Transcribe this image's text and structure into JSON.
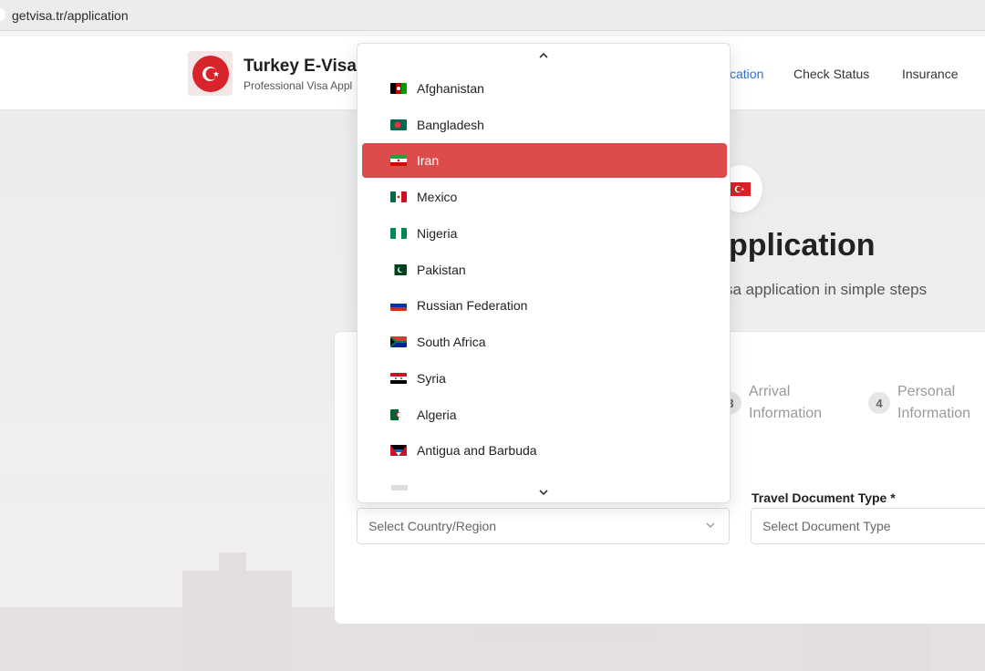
{
  "browser": {
    "url": "getvisa.tr/application"
  },
  "header": {
    "brand_title": "Turkey E-Visa",
    "brand_subtitle": "Professional Visa Appl",
    "nav": {
      "application": "cation",
      "check_status": "Check Status",
      "insurance": "Insurance"
    }
  },
  "hero": {
    "title": "pplication",
    "subtitle": "sa application in simple steps"
  },
  "steps": [
    {
      "number": "3",
      "label_line1": "Arrival",
      "label_line2": "Information"
    },
    {
      "number": "4",
      "label_line1": "Personal",
      "label_line2": "Information"
    }
  ],
  "form": {
    "travel_doc_label": "Travel Document Type *",
    "country_placeholder": "Select Country/Region",
    "doc_placeholder": "Select Document Type"
  },
  "dropdown": {
    "selected": "Iran",
    "options": [
      {
        "label": "Afghanistan",
        "flag": "afghanistan"
      },
      {
        "label": "Bangladesh",
        "flag": "bangladesh"
      },
      {
        "label": "Iran",
        "flag": "iran"
      },
      {
        "label": "Mexico",
        "flag": "mexico"
      },
      {
        "label": "Nigeria",
        "flag": "nigeria"
      },
      {
        "label": "Pakistan",
        "flag": "pakistan"
      },
      {
        "label": "Russian Federation",
        "flag": "russia"
      },
      {
        "label": "South Africa",
        "flag": "south-africa"
      },
      {
        "label": "Syria",
        "flag": "syria"
      },
      {
        "label": "Algeria",
        "flag": "algeria"
      },
      {
        "label": "Antigua and Barbuda",
        "flag": "antigua"
      }
    ]
  },
  "colors": {
    "selected_bg": "#dc4c4a",
    "nav_active": "#2f6fd6",
    "turkey_red": "#d8232a"
  }
}
